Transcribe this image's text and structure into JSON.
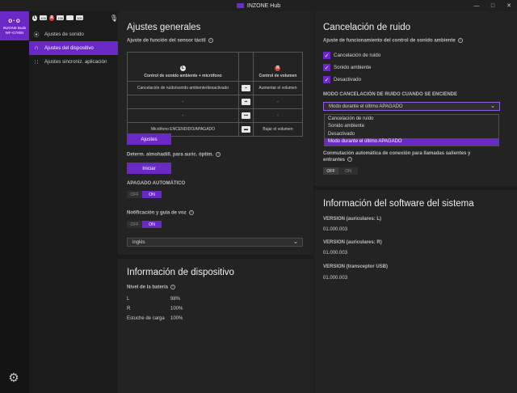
{
  "window": {
    "title": "INZONE Hub",
    "controls": [
      "—",
      "□",
      "✕"
    ]
  },
  "device": {
    "glyph": "ᴏ·ᴏ",
    "name_line1": "INZONE Buds",
    "name_line2": "WF-G700N"
  },
  "status": {
    "items": [
      {
        "type": "circ",
        "text": "L"
      },
      {
        "type": "bat",
        "text": "100"
      },
      {
        "type": "circ red",
        "text": "R"
      },
      {
        "type": "bat",
        "text": "100"
      },
      {
        "type": "bat",
        "text": ""
      },
      {
        "type": "bat",
        "text": "100"
      }
    ]
  },
  "nav": {
    "items": [
      {
        "icon": "⦿",
        "label": "Ajustes de sonido"
      },
      {
        "icon": "∩",
        "label": "Ajustes del dispositivo"
      },
      {
        "icon": "∷",
        "label": "Ajustes sincroniz. aplicación"
      }
    ]
  },
  "general": {
    "title": "Ajustes generales",
    "sensor_label": "Ajuste de función del sensor táctil",
    "col_left_badge": "L",
    "col_left": "Control de sonido ambiente + micrófono",
    "col_right_badge": "R",
    "col_right": "Control de volumen",
    "rows": [
      {
        "left": "Cancelación de ruido/sonido ambiente/desactivado",
        "icon": "▪",
        "right": "Aumentar el volumen"
      },
      {
        "left": "-",
        "icon": "▪▪",
        "right": "-"
      },
      {
        "left": "-",
        "icon": "▪▪▪",
        "right": "-"
      },
      {
        "left": "Micrófono ENCENDIDO/APAGADO",
        "icon": "▬",
        "right": "Bajar el volumen"
      }
    ],
    "adjust_button": "Ajustes",
    "fit_label": "Determ. almohadill. para auric. óptim.",
    "start_button": "Iniciar",
    "auto_off_label": "APAGADO AUTOMÁTICO",
    "auto_off_state": "on",
    "voice_label": "Notificación y guía de voz",
    "voice_state": "on",
    "toggle_off": "OFF",
    "toggle_on": "ON",
    "language_value": "inglés"
  },
  "device_info": {
    "title": "Información de dispositivo",
    "battery_label": "Nivel de la batería",
    "rows": [
      {
        "name": "L",
        "value": "98%"
      },
      {
        "name": "R",
        "value": "100%"
      },
      {
        "name": "Estuche de carga",
        "value": "100%"
      }
    ]
  },
  "noise": {
    "title": "Cancelación de ruido",
    "section_label": "Ajuste de funcionamiento del control de sonido ambiente",
    "checks": [
      {
        "label": "Cancelación de ruido",
        "checked": true
      },
      {
        "label": "Sonido ambiente",
        "checked": true
      },
      {
        "label": "Desactivado",
        "checked": true
      }
    ],
    "mode_label": "MODO CANCELACIÓN DE RUIDO CUANDO SE ENCIENDE",
    "mode_value": "Modo durante el último APAGADO",
    "options": [
      {
        "label": "Cancelación de ruido",
        "selected": false
      },
      {
        "label": "Sonido ambiente",
        "selected": false
      },
      {
        "label": "Desactivado",
        "selected": false
      },
      {
        "label": "Modo durante el último APAGADO",
        "selected": true
      }
    ]
  },
  "connection": {
    "label": "Conmutación automática de conexión para llamadas salientes y entrantes",
    "state": "off",
    "toggle_off": "OFF",
    "toggle_on": "ON"
  },
  "software": {
    "title": "Información del software del sistema",
    "rows": [
      {
        "label": "VERSION (auriculares: L)",
        "value": "01.000.003"
      },
      {
        "label": "VERSION (auriculares: R)",
        "value": "01.000.003"
      },
      {
        "label": "VERSION (transceptor USB)",
        "value": "01.000.003"
      }
    ]
  },
  "colors": {
    "accent": "#6a28c4",
    "panel": "#232323",
    "background": "#1b1b1b"
  },
  "icons": [
    "app-logo-icon",
    "minimize-icon",
    "maximize-icon",
    "close-icon",
    "headphones-icon",
    "speaker-icon",
    "grid-icon",
    "gear-icon",
    "chevron-down-icon",
    "help-icon",
    "check-icon",
    "mic-icon"
  ]
}
